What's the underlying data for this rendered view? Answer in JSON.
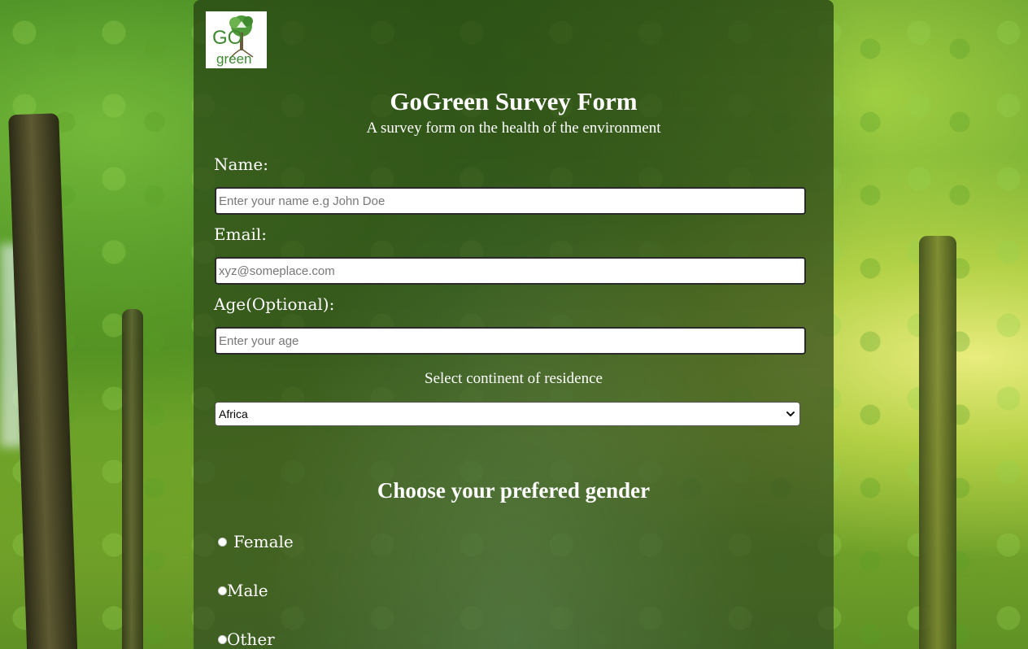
{
  "logo": {
    "text_top": "GO",
    "text_bottom": "green"
  },
  "header": {
    "title": "GoGreen Survey Form",
    "subtitle": "A survey form on the health of the environment"
  },
  "form": {
    "name": {
      "label": "Name:",
      "placeholder": "Enter your name e.g John Doe",
      "value": ""
    },
    "email": {
      "label": "Email:",
      "placeholder": "xyz@someplace.com",
      "value": ""
    },
    "age": {
      "label": "Age(Optional):",
      "placeholder": "Enter your age",
      "value": ""
    },
    "continent": {
      "label": "Select continent of residence",
      "selected": "Africa"
    },
    "gender": {
      "heading": "Choose your prefered gender",
      "options": [
        {
          "label": "Female",
          "selected": false
        },
        {
          "label": "Male",
          "selected": false
        },
        {
          "label": "Other",
          "selected": false
        }
      ]
    }
  },
  "colors": {
    "panel_overlay": "#2d4616",
    "text": "#ffffff",
    "logo_green": "#3c8a2e"
  },
  "icons": [
    "recycle-tree-logo-icon",
    "chevron-down-icon"
  ]
}
